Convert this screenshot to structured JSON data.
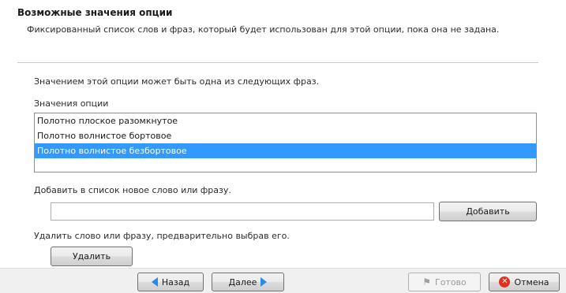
{
  "header": {
    "title": "Возможные значения опции",
    "subtitle": "Фиксированный список слов и фраз, который будет использован для этой опции, пока она не задана."
  },
  "main": {
    "intro": "Значением этой опции может быть одна из следующих фраз.",
    "values_label": "Значения опции",
    "values": [
      {
        "text": "Полотно плоское разомкнутое",
        "selected": false
      },
      {
        "text": "Полотно волнистое бортовое",
        "selected": false
      },
      {
        "text": "Полотно волнистое безбортовое",
        "selected": true
      }
    ],
    "add_label": "Добавить в список новое слово или фразу.",
    "add_input_value": "",
    "add_button": "Добавить",
    "remove_label": "Удалить слово или фразу, предварительно выбрав его.",
    "remove_button": "Удалить"
  },
  "footer": {
    "back_button": "Назад",
    "next_button": "Далее",
    "finish_button": "Готово",
    "cancel_button": "Отмена"
  },
  "colors": {
    "selection": "#3399ff",
    "arrow": "#2a8be0",
    "cancel_icon": "#e0301e"
  },
  "icons": {
    "back": "arrow-left-icon",
    "next": "arrow-right-icon",
    "finish": "flag-icon",
    "cancel": "cancel-icon"
  }
}
